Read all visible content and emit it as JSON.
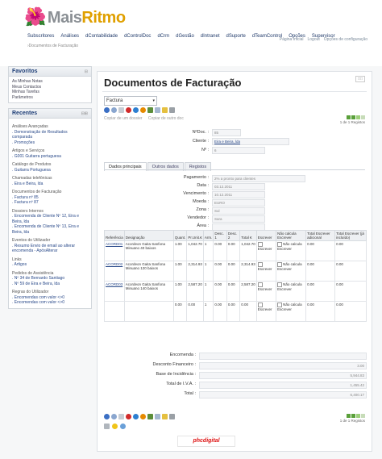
{
  "app": {
    "logo_prefix": "Mais",
    "logo_accent": "Ritmo"
  },
  "topnav": [
    "Subscritores",
    "Análises",
    "dContabilidade",
    "dControlDoc",
    "dCrm",
    "dGestão",
    "dIntranet",
    "dSuporte",
    "dTeamControl",
    "Opções",
    "Supervisor"
  ],
  "toplinks": [
    "Página Inicial",
    "Logout",
    "Opções de configuração"
  ],
  "breadcrumb": "›Documentos de Facturação",
  "favorites": {
    "title": "Favoritos",
    "items": [
      "As Minhas Notas",
      "Meus Contactos",
      "Minhas Tarefas",
      "Parâmetros"
    ]
  },
  "recent": {
    "title": "Recentes",
    "groups": [
      {
        "title": "Análises Avançadas",
        "items": [
          ". Demonstração de Resultados comparada",
          ". Promoções"
        ]
      },
      {
        "title": "Artigos e Serviços",
        "items": [
          ". G001 Guitarra portuguesa"
        ]
      },
      {
        "title": "Catálogo de Produtos",
        "items": [
          ". Guitarra Portuguesa"
        ]
      },
      {
        "title": "Chamadas telefónicas",
        "items": [
          ". Eira e Beira, lda"
        ]
      },
      {
        "title": "Documentos de Facturação",
        "items": [
          ". Factura nº 85",
          ". Factura nº 87"
        ]
      },
      {
        "title": "Dossiers Internos",
        "items": [
          ". Encomenda de Cliente Nº 12, Eira e Beira, lda",
          ". Encomenda de Cliente Nº 13, Eira e Beira, lda"
        ]
      },
      {
        "title": "Eventos do Utilizador",
        "items": [
          ". Resumo Envio de email ao alterar encomenda - ApósAlterar"
        ]
      },
      {
        "title": "Links",
        "items": [
          ". Artigos"
        ]
      },
      {
        "title": "Pedidos de Assistência",
        "items": [
          ". Nº 34 de Bernardo Santiago",
          ". Nº 59 de Eira e Beira, lda"
        ]
      },
      {
        "title": "Regras do Utilizador",
        "items": [
          ". Encomendas com valor <>0",
          ". Encomendas com valor <>0"
        ]
      }
    ]
  },
  "main": {
    "title": "Documentos de Facturação",
    "doc_type": "Factura",
    "copy_links": [
      "Copiar de um dossier",
      "Copiar de outro doc"
    ],
    "pager": "1 de 1 Registos",
    "header_fields": [
      {
        "label": "NºDoc. :",
        "value": "85"
      },
      {
        "label": "Cliente :",
        "value": "Eira e Beira, lda"
      },
      {
        "label": "Nº :",
        "value": "6"
      }
    ],
    "tabs": [
      "Dados principais",
      "Outros dados",
      "Registos"
    ],
    "detail_fields": [
      {
        "label": "Pagamento :",
        "value": "2% a pronto para clientes"
      },
      {
        "label": "Data :",
        "value": "03.12.2011"
      },
      {
        "label": "Vencimento :",
        "value": "10.12.2011"
      },
      {
        "label": "Moeda :",
        "value": "EURO"
      },
      {
        "label": "Zona :",
        "value": "Sul"
      },
      {
        "label": "Vendedor :",
        "value": "Sara"
      },
      {
        "label": "Área :",
        "value": ""
      }
    ],
    "table": {
      "columns": [
        "Referência",
        "Designação",
        "Quant.",
        "Pr.Unit.€",
        "Arm.",
        "Desc. 1",
        "Desc. 2",
        "Total €",
        "Escrever",
        "Não calcula Escrever",
        "Total Escrever adicional",
        "Total Escrever (já incluído)"
      ],
      "rows": [
        {
          "ref": "ACORD01",
          "desc": "Acordeon Gaita Sanfona Minuano 40 baixos",
          "qty": "1.00",
          "price": "1,042.70",
          "arm": "1",
          "d1": "0.00",
          "d2": "0.00",
          "total": "1,042.70",
          "e1": "Escrever",
          "e2": "Não calcula Escrever",
          "t1": "0.00",
          "t2": "0.00"
        },
        {
          "ref": "ACORD02",
          "desc": "Acordeon Gaita Sanfona Minuano 120 baixos",
          "qty": "1.00",
          "price": "2,314.93",
          "arm": "1",
          "d1": "0.00",
          "d2": "0.00",
          "total": "2,314.93",
          "e1": "Escrever",
          "e2": "Não calcula Escrever",
          "t1": "0.00",
          "t2": "0.00"
        },
        {
          "ref": "ACORD03",
          "desc": "Acordeon Gaita Sanfona Minuano 140 baixos",
          "qty": "1.00",
          "price": "2,587.20",
          "arm": "1",
          "d1": "0.00",
          "d2": "0.00",
          "total": "2,587.20",
          "e1": "Escrever",
          "e2": "Não calcula Escrever",
          "t1": "0.00",
          "t2": "0.00"
        },
        {
          "ref": "",
          "desc": "",
          "qty": "0.00",
          "price": "0.00",
          "arm": "1",
          "d1": "0.00",
          "d2": "0.00",
          "total": "0.00",
          "e1": "Escrever",
          "e2": "Não calcula Escrever",
          "t1": "0.00",
          "t2": "0.00"
        }
      ]
    },
    "totals": [
      {
        "label": "Encomenda :",
        "value": ""
      },
      {
        "label": "Desconto Financeiro :",
        "value": "3.00"
      },
      {
        "label": "Base de Incidência :",
        "value": "5,944.83"
      },
      {
        "label": "Total de I.V.A. :",
        "value": "1,455.42"
      },
      {
        "label": "Total :",
        "value": "6,400.17"
      }
    ],
    "bottom_pager": "1 de 1 Registos"
  },
  "footer": {
    "brand": "phcdigital"
  },
  "colors": {
    "accent": "#e0a000",
    "link": "#2a4a8a",
    "nav": "#203a6a"
  }
}
